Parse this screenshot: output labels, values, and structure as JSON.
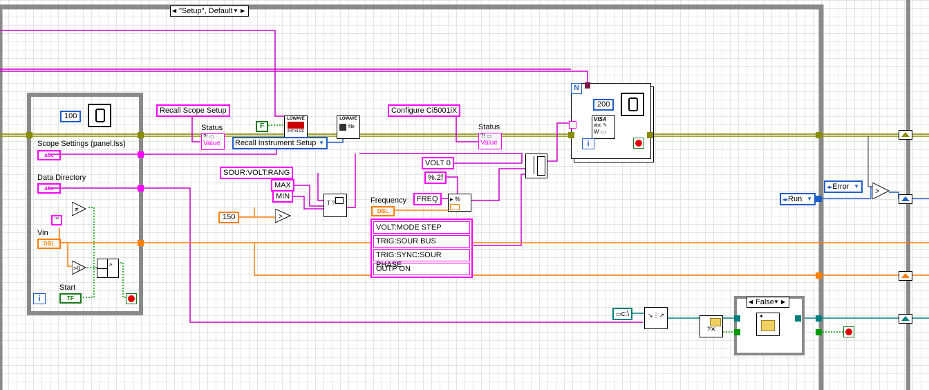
{
  "case_selector": {
    "label": "\"Setup\", Default"
  },
  "scope_loop": {
    "timeout_value": "100",
    "scope_settings_label": "Scope Settings (panel.lss)",
    "scope_settings_type": "abc",
    "data_directory_label": "Data Directory",
    "data_directory_type": "abc",
    "empty_string": "\"\"",
    "vin_label": "Vin",
    "vin_type": "DBL",
    "start_label": "Start",
    "start_type": "TF",
    "iteration": "i"
  },
  "recall": {
    "recall_setup_text": "Recall Scope Setup",
    "status_label": "Status",
    "status_value": "Value",
    "false_const": "F",
    "lowave_label": "LOWAVE",
    "initialize_label": "INITIALIZE",
    "recall_ring": "Recall Instrument Setup",
    "file_label": "file"
  },
  "source_cmds": {
    "sour_volt_rang": "SOUR:VOLT:RANG",
    "max": "MAX",
    "min": "MIN",
    "value_150": "150"
  },
  "configure": {
    "configure_text": "Configure Ci5001iX",
    "status_label": "Status",
    "status_value": "Value",
    "volt0": "VOLT 0",
    "format": "%.2f",
    "freq": "FREQ",
    "frequency_label": "Frequency",
    "frequency_type": "DBL",
    "commands": [
      "VOLT:MODE STEP",
      "TRIG:SOUR BUS",
      "TRIG:SYNC:SOUR PHASE",
      "OUTP ON"
    ]
  },
  "visa_loop": {
    "n_label": "N",
    "wait_value": "200",
    "visa_label": "VISA",
    "iteration": "i"
  },
  "right_side": {
    "run_ring": "Run",
    "error_ring": "Error",
    "path_const": "c:\\",
    "false_ring": "False"
  },
  "colors": {
    "string_wire": "#cc00cc",
    "cluster_wire": "#8b8b00",
    "numeric_wire": "#ff7f00",
    "path_wire": "#007f7f",
    "bool_wire": "#009900",
    "structure": "#8a8a8a"
  }
}
